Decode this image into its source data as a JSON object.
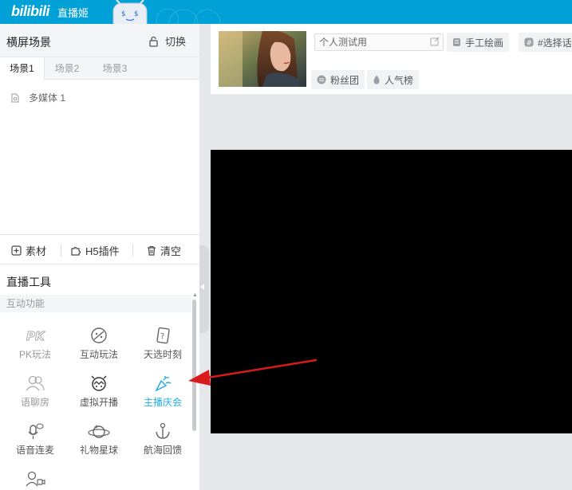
{
  "topbar": {
    "logo": "bilibili",
    "app_name": "直播姬"
  },
  "scene": {
    "title": "横屏场景",
    "switch_label": "切换",
    "tabs": [
      {
        "label": "场景1",
        "active": true
      },
      {
        "label": "场景2",
        "active": false
      },
      {
        "label": "场景3",
        "active": false
      }
    ],
    "sources": [
      {
        "label": "多媒体 1"
      }
    ]
  },
  "toolbar": {
    "material": "素材",
    "h5_plugin": "H5插件",
    "clear": "清空"
  },
  "live_tools": {
    "title": "直播工具",
    "section_label": "互动功能",
    "items": [
      {
        "label": "PK玩法",
        "icon": "pk-icon",
        "state": "dim"
      },
      {
        "label": "互动玩法",
        "icon": "gamepad-icon",
        "state": "normal"
      },
      {
        "label": "天选时刻",
        "icon": "lottery-card-icon",
        "state": "normal"
      },
      {
        "label": "语聊房",
        "icon": "people-icon",
        "state": "dim"
      },
      {
        "label": "虚拟开播",
        "icon": "virtual-avatar-icon",
        "state": "normal"
      },
      {
        "label": "主播庆会",
        "icon": "party-popper-icon",
        "state": "highlight"
      },
      {
        "label": "语音连麦",
        "icon": "mic-chat-icon",
        "state": "normal"
      },
      {
        "label": "礼物星球",
        "icon": "planet-icon",
        "state": "normal"
      },
      {
        "label": "航海回馈",
        "icon": "anchor-icon",
        "state": "normal"
      },
      {
        "label": "",
        "icon": "video-user-icon",
        "state": "normal"
      }
    ]
  },
  "room": {
    "title_value": "个人测试用",
    "category": "手工绘画",
    "tag": "#选择话",
    "fan_club": "粉丝团",
    "popularity": "人气榜"
  },
  "colors": {
    "topbar": "#00a1d6",
    "highlight": "#23ade5",
    "arrow": "#d91a1a"
  }
}
